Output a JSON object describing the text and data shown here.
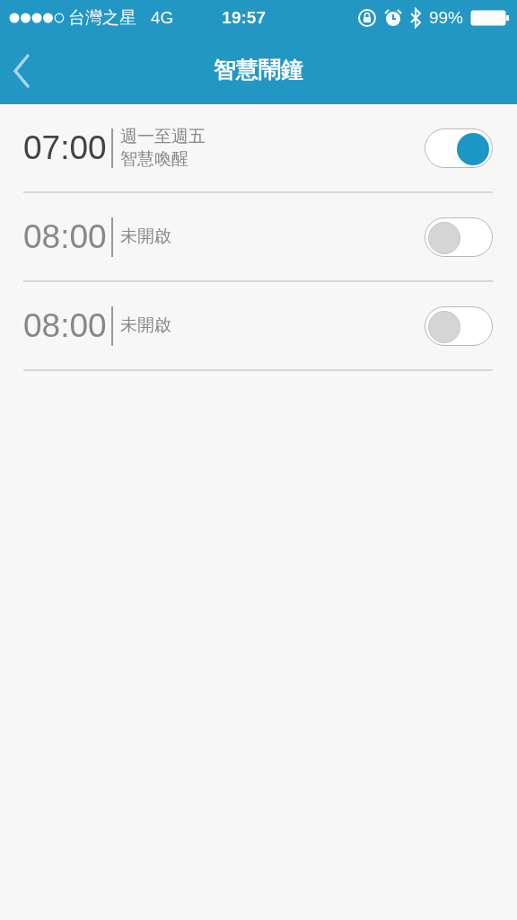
{
  "status_bar": {
    "carrier": "台灣之星",
    "network": "4G",
    "time": "19:57",
    "battery": "99%"
  },
  "nav": {
    "title": "智慧鬧鐘"
  },
  "alarms": [
    {
      "time": "07:00",
      "lines": [
        "週一至週五",
        "智慧喚醒"
      ],
      "on": true
    },
    {
      "time": "08:00",
      "lines": [
        "未開啟"
      ],
      "on": false
    },
    {
      "time": "08:00",
      "lines": [
        "未開啟"
      ],
      "on": false
    }
  ]
}
